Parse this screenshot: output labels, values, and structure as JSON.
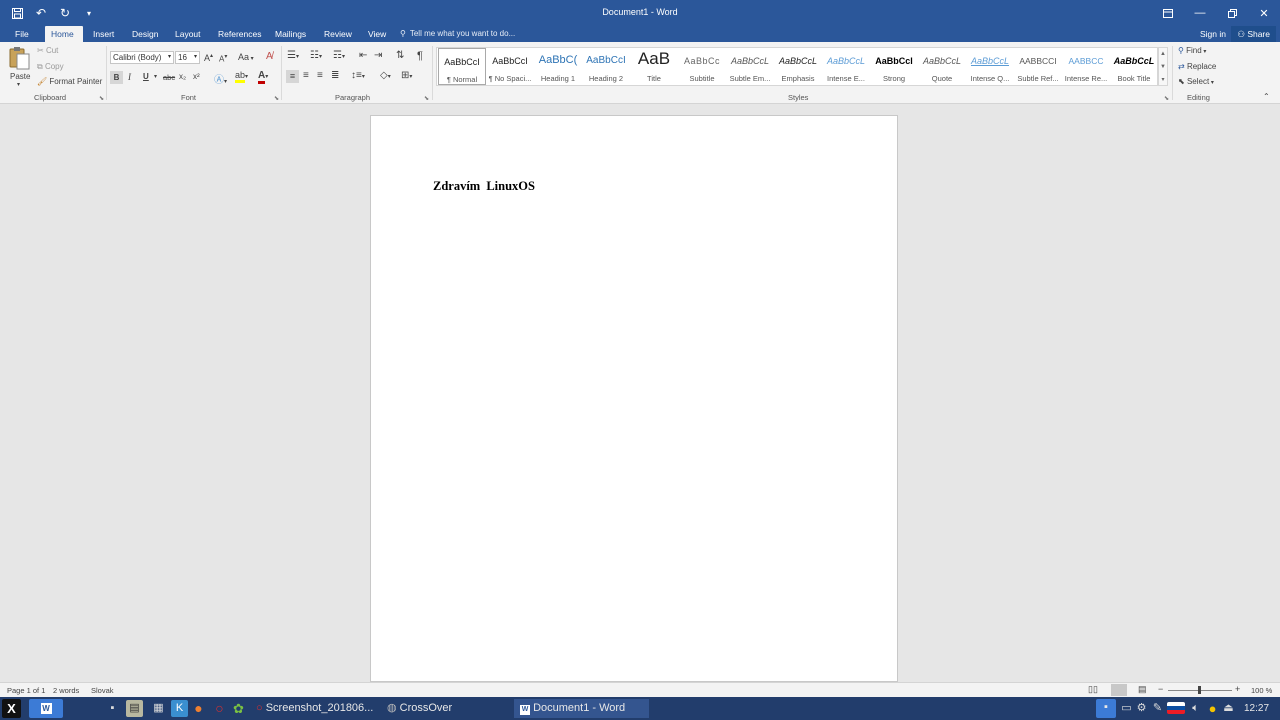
{
  "window": {
    "title": "Document1 - Word"
  },
  "qat": {
    "save_icon": "save-icon",
    "undo_icon": "undo-icon",
    "redo_icon": "redo-icon",
    "customize_icon": "qat-customize-icon"
  },
  "tabs": [
    "File",
    "Home",
    "Insert",
    "Design",
    "Layout",
    "References",
    "Mailings",
    "Review",
    "View"
  ],
  "tell_me": "Tell me what you want to do...",
  "account": {
    "sign_in": "Sign in",
    "share": "Share"
  },
  "clipboard": {
    "paste": "Paste",
    "cut": "Cut",
    "copy": "Copy",
    "format_painter": "Format Painter",
    "label": "Clipboard"
  },
  "font": {
    "name": "Calibri (Body)",
    "size": "16",
    "label": "Font",
    "bold": "B",
    "italic": "I",
    "underline": "U",
    "strike": "abc",
    "subscript": "x₂",
    "superscript": "x²",
    "grow": "A",
    "shrink": "A",
    "case": "Aa"
  },
  "paragraph": {
    "label": "Paragraph",
    "pilcrow": "¶"
  },
  "styles": {
    "label": "Styles",
    "items": [
      {
        "preview": "AaBbCcI",
        "name": "¶ Normal"
      },
      {
        "preview": "AaBbCcI",
        "name": "¶ No Spaci..."
      },
      {
        "preview": "AaBbC(",
        "name": "Heading 1"
      },
      {
        "preview": "AaBbCcI",
        "name": "Heading 2"
      },
      {
        "preview": "AaB",
        "name": "Title"
      },
      {
        "preview": "AaBbCc",
        "name": "Subtitle"
      },
      {
        "preview": "AaBbCcL",
        "name": "Subtle Em..."
      },
      {
        "preview": "AaBbCcL",
        "name": "Emphasis"
      },
      {
        "preview": "AaBbCcL",
        "name": "Intense E..."
      },
      {
        "preview": "AaBbCcl",
        "name": "Strong"
      },
      {
        "preview": "AaBbCcL",
        "name": "Quote"
      },
      {
        "preview": "AaBbCcL",
        "name": "Intense Q..."
      },
      {
        "preview": "AABBCCI",
        "name": "Subtle Ref..."
      },
      {
        "preview": "AABBCC",
        "name": "Intense Re..."
      },
      {
        "preview": "AaBbCcL",
        "name": "Book Title"
      }
    ]
  },
  "editing": {
    "find": "Find",
    "replace": "Replace",
    "select": "Select",
    "label": "Editing"
  },
  "document": {
    "text": "Zdravím LinuxOS"
  },
  "status": {
    "page": "Page 1 of 1",
    "words": "2 words",
    "language": "Slovak",
    "zoom": "100 %"
  },
  "taskbar": {
    "tasks": [
      {
        "label": "Screenshot_201806..."
      },
      {
        "label": "CrossOver"
      },
      {
        "label": "Document1 - Word"
      }
    ],
    "clock": "12:27"
  },
  "colors": {
    "accent": "#2b579a",
    "taskbar": "#223d6c",
    "font_color": "#c00000",
    "highlight": "#ffff00"
  }
}
